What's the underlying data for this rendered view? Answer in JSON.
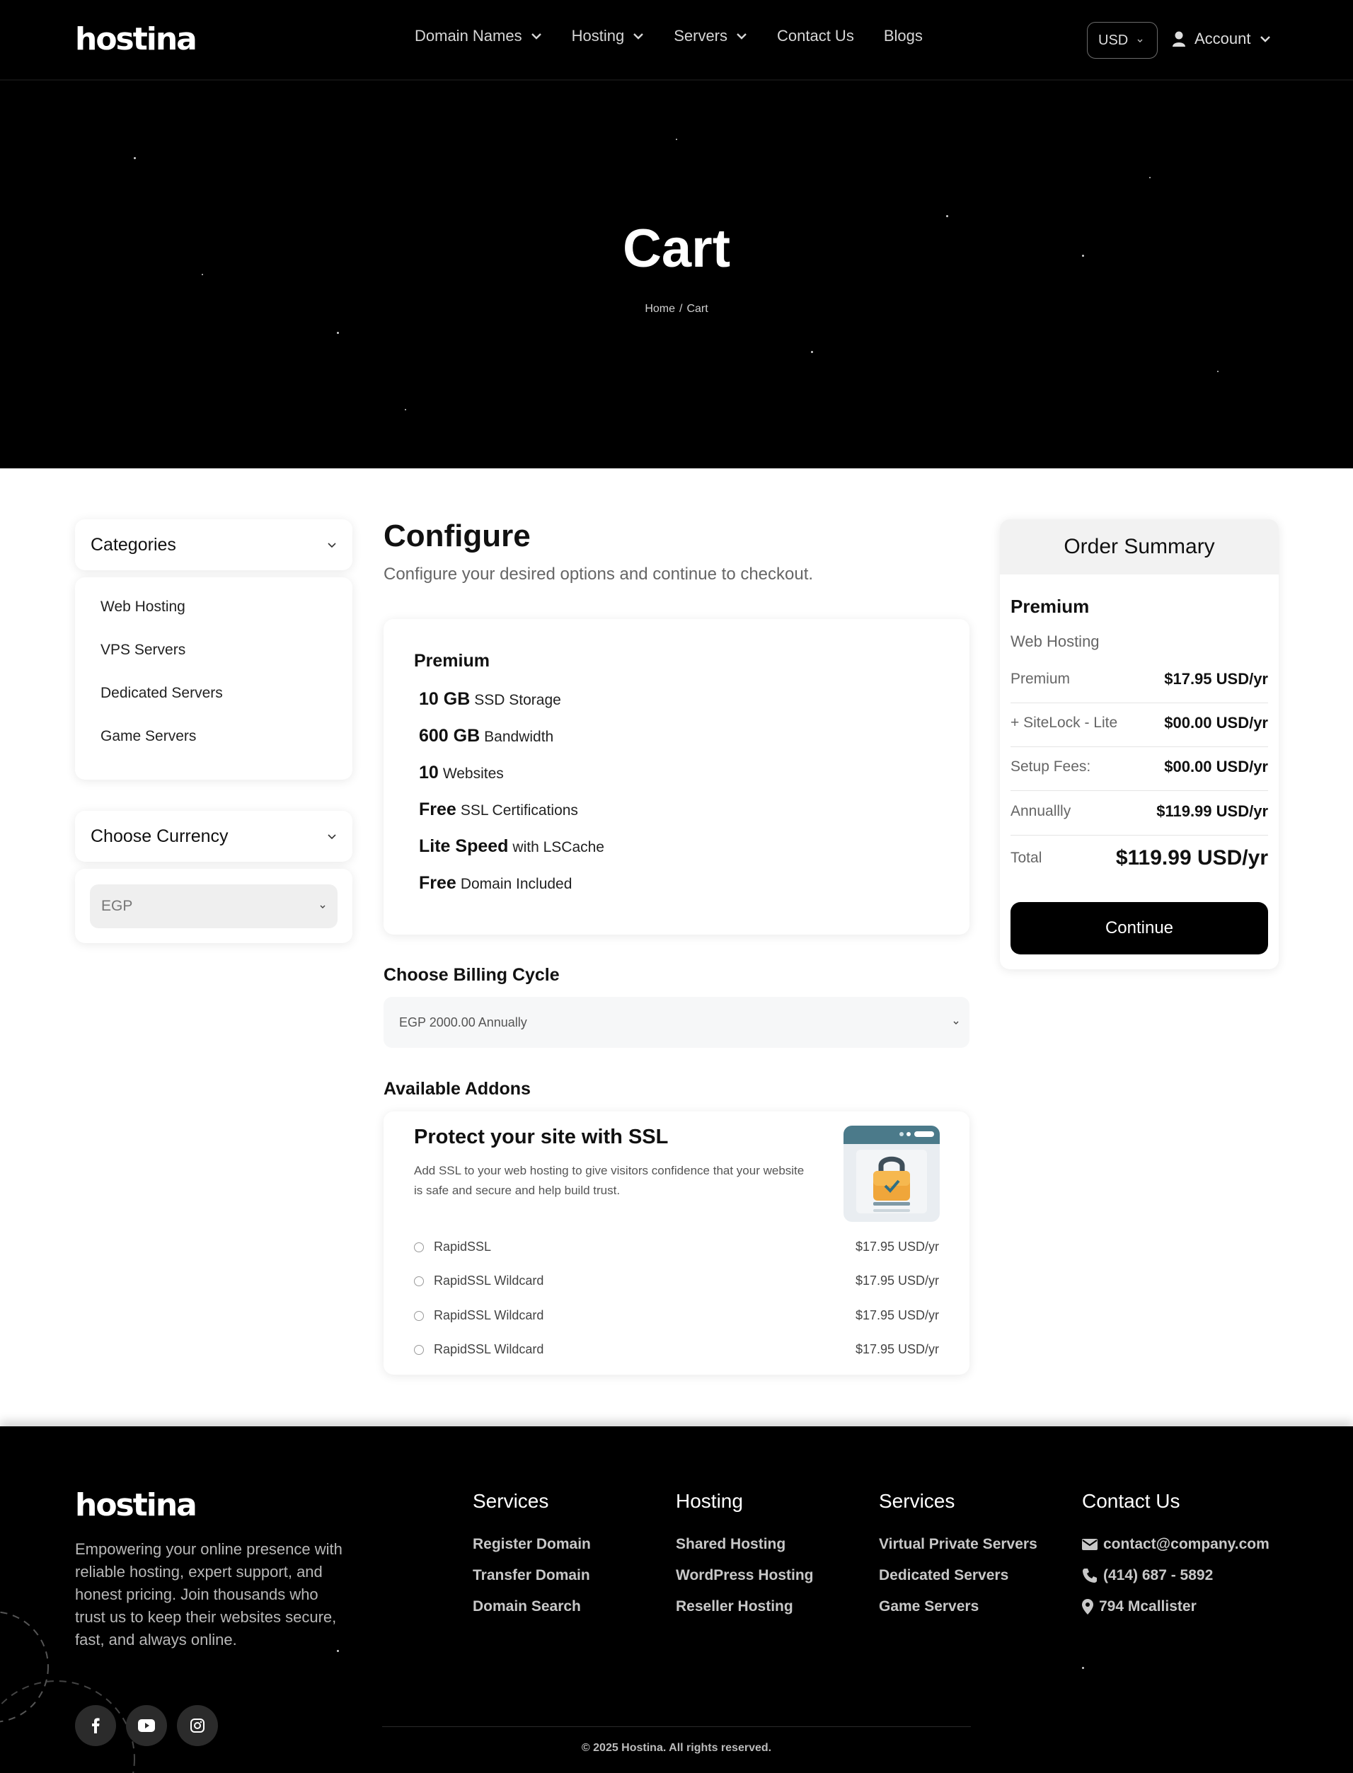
{
  "header": {
    "logo": "hostina",
    "nav": [
      "Domain Names",
      "Hosting",
      "Servers",
      "Contact Us",
      "Blogs"
    ],
    "currency": "USD",
    "account": "Account"
  },
  "hero": {
    "title": "Cart",
    "breadcrumb": {
      "home": "Home",
      "separator": "/",
      "current": "Cart"
    }
  },
  "sidebar": {
    "categories_title": "Categories",
    "categories": [
      "Web Hosting",
      "VPS Servers",
      "Dedicated Servers",
      "Game Servers"
    ],
    "currency_title": "Choose Currency",
    "currency_value": "EGP"
  },
  "configure": {
    "title": "Configure",
    "subtitle": "Configure your desired options and continue to checkout.",
    "plan": {
      "name": "Premium",
      "features": [
        {
          "value": "10 GB",
          "label": "SSD Storage"
        },
        {
          "value": "600 GB",
          "label": "Bandwidth"
        },
        {
          "value": "10",
          "label": "Websites"
        },
        {
          "value": "Free",
          "label": "SSL Certifications"
        },
        {
          "value": "Lite Speed",
          "label": "with LSCache"
        },
        {
          "value": "Free",
          "label": "Domain Included"
        }
      ]
    },
    "billing_title": "Choose Billing Cycle",
    "billing_value": "EGP 2000.00 Annually",
    "addons_title": "Available Addons",
    "ssl": {
      "title": "Protect your site with SSL",
      "description": "Add SSL to your web hosting to give visitors confidence that your website is safe and secure and help build trust.",
      "options": [
        {
          "name": "RapidSSL",
          "price": "$17.95 USD/yr"
        },
        {
          "name": "RapidSSL Wildcard",
          "price": "$17.95 USD/yr"
        },
        {
          "name": "RapidSSL Wildcard",
          "price": "$17.95 USD/yr"
        },
        {
          "name": "RapidSSL Wildcard",
          "price": "$17.95 USD/yr"
        }
      ]
    }
  },
  "summary": {
    "title": "Order Summary",
    "plan": "Premium",
    "category": "Web Hosting",
    "rows": [
      {
        "label": "Premium",
        "value": "$17.95 USD/yr"
      },
      {
        "label": "+ SiteLock - Lite",
        "value": "$00.00 USD/yr"
      },
      {
        "label": "Setup Fees:",
        "value": "$00.00 USD/yr"
      },
      {
        "label": "Annuallly",
        "value": "$119.99 USD/yr"
      }
    ],
    "total_label": "Total",
    "total_value": "$119.99 USD/yr",
    "continue": "Continue"
  },
  "footer": {
    "logo": "hostina",
    "description": "Empowering your online presence with reliable hosting, expert support, and honest pricing. Join thousands who trust us to keep their websites secure, fast, and always online.",
    "columns": [
      {
        "title": "Services",
        "links": [
          "Register Domain",
          "Transfer Domain",
          "Domain Search"
        ]
      },
      {
        "title": "Hosting",
        "links": [
          "Shared Hosting",
          "WordPress Hosting",
          "Reseller Hosting"
        ]
      },
      {
        "title": "Services",
        "links": [
          "Virtual Private Servers",
          "Dedicated Servers",
          "Game Servers"
        ]
      }
    ],
    "contact": {
      "title": "Contact Us",
      "email": "contact@company.com",
      "phone": "(414) 687 - 5892",
      "address": "794 Mcallister"
    },
    "social": [
      "facebook-icon",
      "youtube-icon",
      "instagram-icon"
    ],
    "copyright": "© 2025 Hostina. All rights reserved."
  },
  "colors": {
    "accent": "#000000",
    "page_bg": "#ffffff",
    "muted_text": "#666666"
  }
}
